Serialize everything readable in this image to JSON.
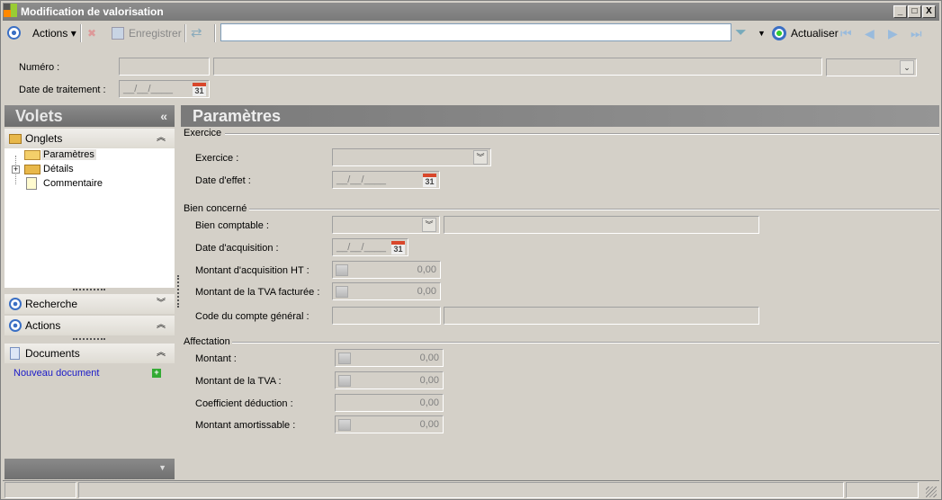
{
  "window": {
    "title": "Modification de valorisation",
    "minimize": "_",
    "maximize": "□",
    "close": "X"
  },
  "toolbar": {
    "actions": "Actions",
    "save": "Enregistrer",
    "search_value": "",
    "refresh": "Actualiser"
  },
  "header": {
    "numero_label": "Numéro :",
    "date_label": "Date de traitement :",
    "date_value": "__/__/____"
  },
  "sidebar": {
    "title": "Volets",
    "collapse": "«",
    "onglets": "Onglets",
    "tree": [
      {
        "label": "Paramètres"
      },
      {
        "label": "Détails"
      },
      {
        "label": "Commentaire"
      }
    ],
    "recherche": "Recherche",
    "actions": "Actions",
    "documents": "Documents",
    "new_doc": "Nouveau document"
  },
  "main": {
    "title": "Paramètres",
    "exercice_group": "Exercice",
    "exercice_label": "Exercice :",
    "date_effet_label": "Date d'effet :",
    "date_effet_value": "__/__/____",
    "bien_group": "Bien concerné",
    "bien_label": "Bien comptable :",
    "date_acq_label": "Date d'acquisition :",
    "date_acq_value": "__/__/____",
    "montant_acq_label": "Montant d'acquisition HT :",
    "montant_acq_value": "0,00",
    "tva_fact_label": "Montant de la TVA facturée :",
    "tva_fact_value": "0,00",
    "code_label": "Code du compte général :",
    "affect_group": "Affectation",
    "montant_label": "Montant :",
    "montant_value": "0,00",
    "tva_label": "Montant de la TVA  :",
    "tva_value": "0,00",
    "coef_label": "Coefficient déduction :",
    "coef_value": "0,00",
    "amort_label": "Montant amortissable :",
    "amort_value": "0,00"
  }
}
